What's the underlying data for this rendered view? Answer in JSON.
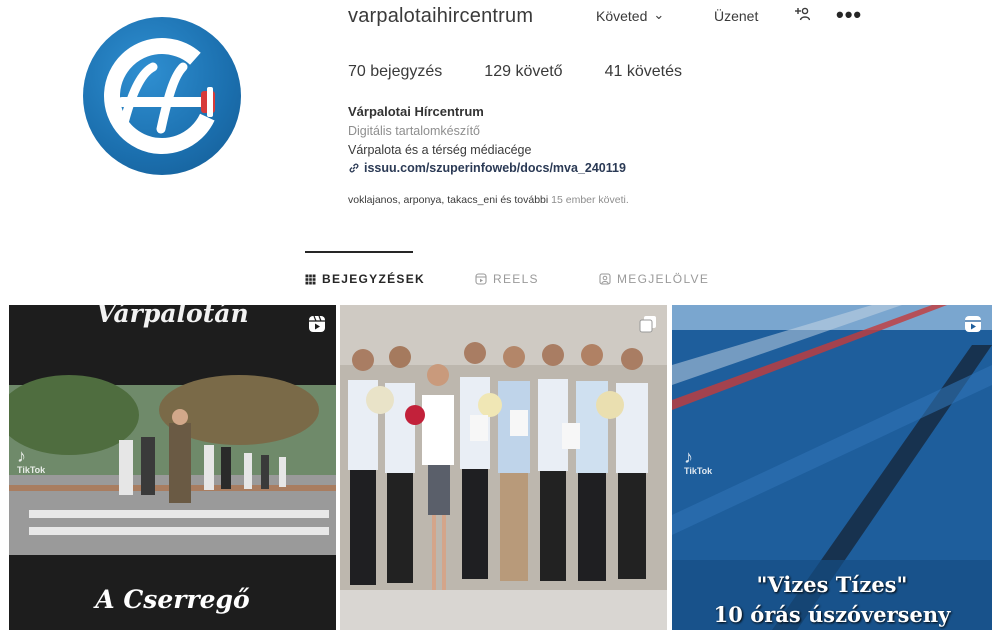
{
  "profile": {
    "username": "varpalotaihircentrum",
    "follow_label": "Követed",
    "message_label": "Üzenet",
    "add_user_icon": "add-user-icon",
    "more_icon": "more-options-icon"
  },
  "stats": {
    "posts": "70 bejegyzés",
    "followers": "129 követő",
    "following": "41 követés"
  },
  "bio": {
    "name": "Várpalotai Hírcentrum",
    "category": "Digitális tartalomkészítő",
    "description": "Várpalota és a térség médiacége",
    "link": "issuu.com/szuperinfoweb/docs/mva_240119",
    "followed_by_names": "voklajanos, arponya, takacs_eni és további",
    "followed_by_rest": "15 ember követi."
  },
  "tabs": [
    {
      "label": "BEJEGYZÉSEK",
      "icon": "grid-icon",
      "active": true
    },
    {
      "label": "REELS",
      "icon": "reels-icon",
      "active": false
    },
    {
      "label": "MEGJELÖLVE",
      "icon": "tagged-icon",
      "active": false
    }
  ],
  "posts": [
    {
      "type": "reel",
      "top_text": "Várpalotán",
      "bottom_text": "A Cserregő",
      "watermark": "TikTok"
    },
    {
      "type": "carousel"
    },
    {
      "type": "reel",
      "line1": "\"Vizes Tízes\"",
      "line2": "10 órás úszóverseny",
      "watermark": "TikTok"
    }
  ],
  "colors": {
    "logo_blue": "#1b6fae",
    "text": "#262626",
    "muted": "#8e8e8e",
    "pool_blue": "#1f5f9b"
  }
}
